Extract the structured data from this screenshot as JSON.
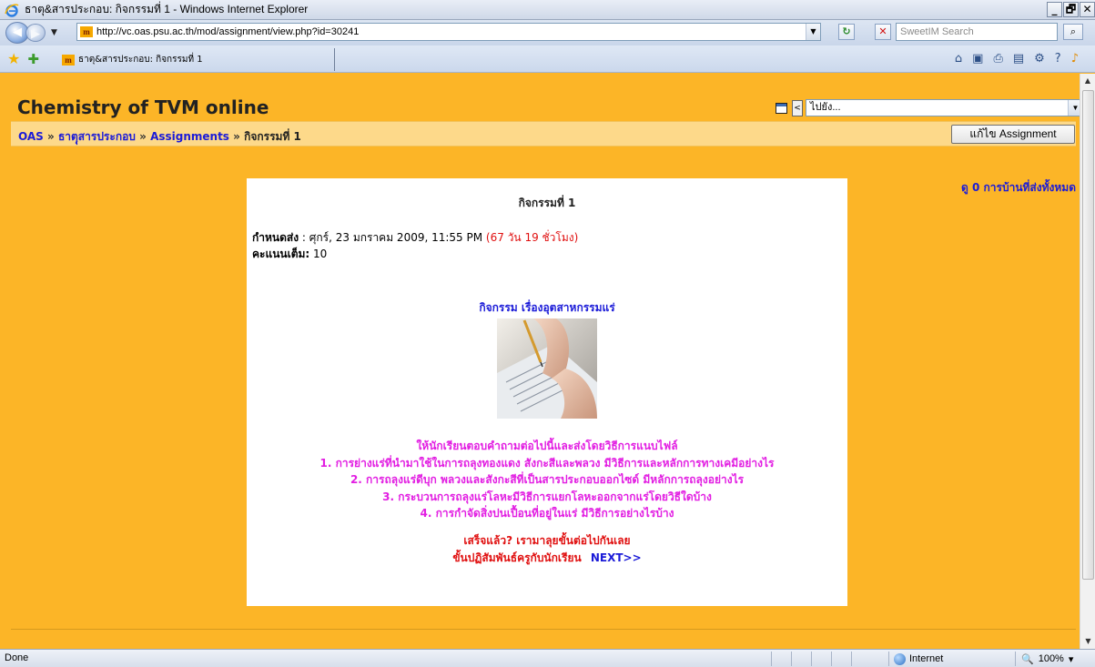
{
  "window": {
    "title": "ธาตุ&สารประกอบ: กิจกรรมที่ 1 - Windows Internet Explorer",
    "controls": [
      "_",
      "🗗",
      "✕"
    ]
  },
  "address": {
    "url": "http://vc.oas.psu.ac.th/mod/assignment/view.php?id=30241",
    "search_placeholder": "SweetIM Search"
  },
  "tab": {
    "title": "ธาตุ&สารประกอบ: กิจกรรมที่ 1"
  },
  "site": {
    "title": "Chemistry of TVM online"
  },
  "jump": {
    "selected": "ไปยัง...",
    "prev": "<",
    "next": ">"
  },
  "breadcrumb": {
    "items": [
      "OAS",
      "ธาตฺุสารประกอบ",
      "Assignments",
      "กิจกรรมที่ 1"
    ],
    "separator": "»"
  },
  "edit_button": "แก้ไข Assignment",
  "submissions_link": "ดู 0 การบ้านที่ส่งทั้งหมด",
  "assignment": {
    "heading": "กิจกรรมที่ 1",
    "due_label": "กำหนดส่ง",
    "due_value": "ศุกร์, 23 มกราคม 2009, 11:55 PM",
    "time_left": "(67 วัน 19 ชั่วโมง)",
    "grade_label": "คะแนนเต็ม:",
    "grade_value": "10",
    "subject": "กิจกรรม เรื่องอุตสาหกรรมแร่",
    "instructions": [
      "ให้นักเรียนตอบคำถามต่อไปนี้และส่งโดยวิธีการแนบไฟล์",
      "1. การย่างแร่ที่นำมาใช้ในการถลุงทองแดง สังกะสีและพลวง มีวิธีการและหลักการทางเคมีอย่างไร",
      "2. การถลุงแร่ดีบุก พลวงและสังกะสีที่เป็นสารประกอบออกไซด์ มีหลักการถลุงอย่างไร",
      "3. กระบวนการถลุงแร่โลหะมีวิธีการแยกโลหะออกจากแร่โดยวิธีใดบ้าง",
      "4. การกำจัดสิ่งปนเปื้อนที่อยู่ในแร่ มีวิธีการอย่างไรบ้าง"
    ],
    "done_line": "เสร็จแล้ว? เรามาลุยขั้นต่อไปกันเลย",
    "next_step": "ขั้นปฏิสัมพันธ์ครูกับนักเรียน",
    "next_link": "NEXT>>"
  },
  "status": {
    "text": "Done",
    "zone": "Internet",
    "zoom": "100%"
  },
  "colors": {
    "page_bg": "#fcb527",
    "nav_strip": "#fdd98a",
    "link": "#1b1bd8",
    "magenta": "#e21ee2",
    "red": "#e01010"
  }
}
